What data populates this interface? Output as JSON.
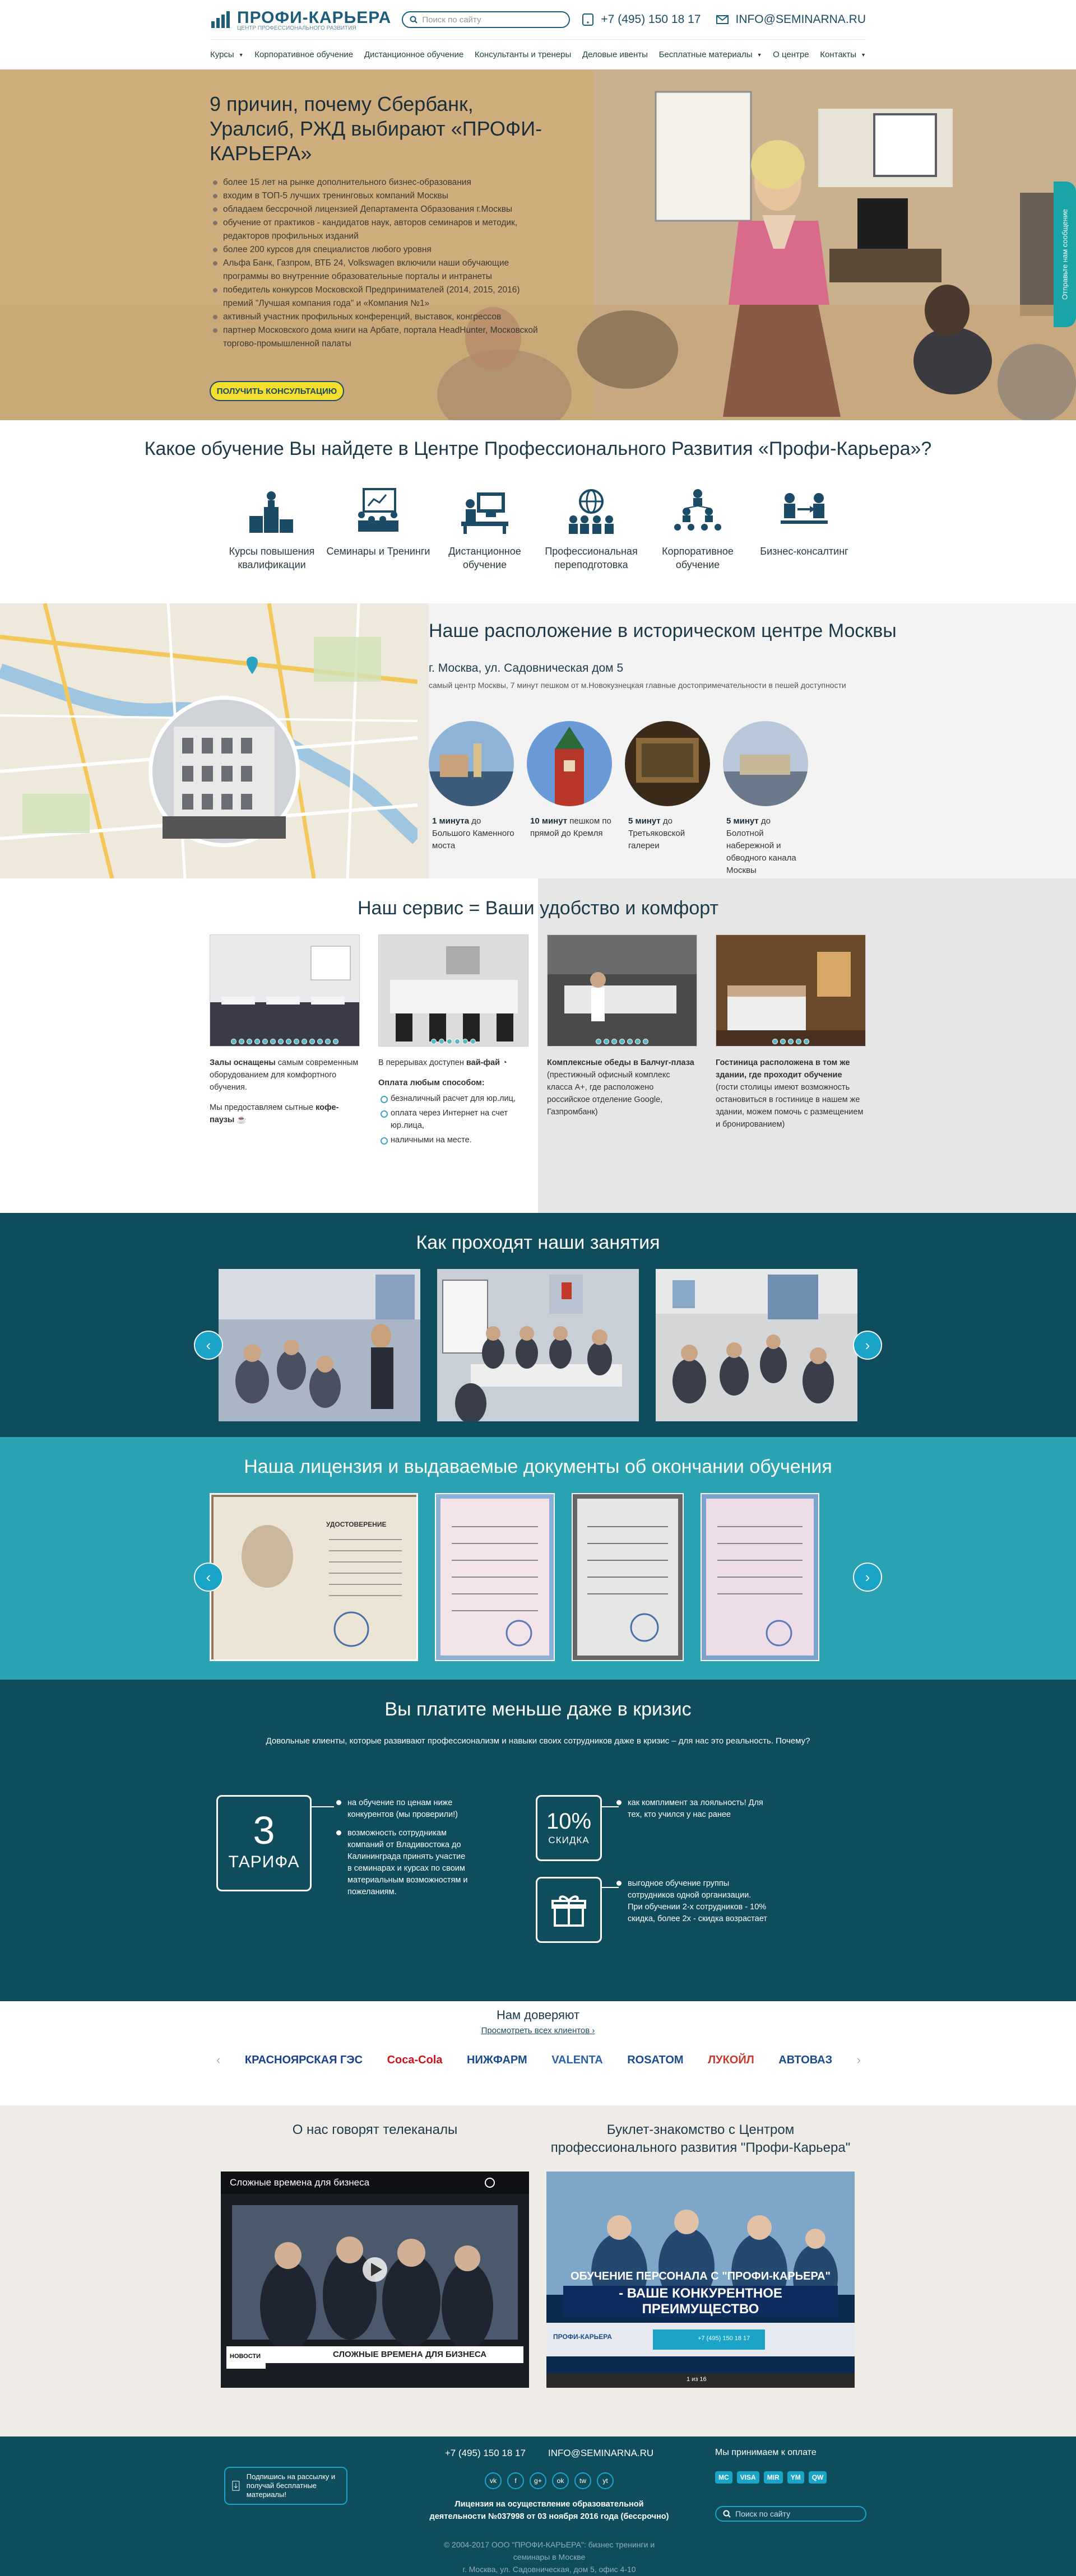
{
  "header": {
    "logo_name": "ПРОФИ-КАРЬЕРА",
    "logo_tagline": "ЦЕНТР ПРОФЕССИОНАЛЬНОГО РАЗВИТИЯ",
    "search_placeholder": "Поиск по сайту",
    "phone": "+7 (495) 150 18 17",
    "email": "INFO@SEMINARNA.RU",
    "nav": [
      {
        "label": "Курсы",
        "caret": true
      },
      {
        "label": "Корпоративное обучение",
        "caret": false
      },
      {
        "label": "Дистанционное обучение",
        "caret": false
      },
      {
        "label": "Консультанты и тренеры",
        "caret": false
      },
      {
        "label": "Деловые ивенты",
        "caret": false
      },
      {
        "label": "Бесплатные материалы",
        "caret": true
      },
      {
        "label": "О центре",
        "caret": false
      },
      {
        "label": "Контакты",
        "caret": true
      }
    ]
  },
  "hero": {
    "title": "9 причин, почему Сбербанк, Уралсиб, РЖД выбирают «ПРОФИ-КАРЬЕРА»",
    "reasons": [
      "более 15 лет на рынке дополнительного бизнес-образования",
      "входим в ТОП-5 лучших тренинговых компаний Москвы",
      "обладаем бессрочной лицензией Департамента Образования г.Москвы",
      "обучение от практиков - кандидатов наук, авторов семинаров и методик, редакторов профильных изданий",
      "более 200 курсов для специалистов любого уровня",
      "Альфа Банк, Газпром, ВТБ 24, Volkswagen включили наши обучающие программы во внутренние образовательные порталы и интранеты",
      "победитель конкурсов Московской Предпринимателей (2014, 2015, 2016) премий \"Лучшая компания года\" и «Компания №1»",
      "активный участник профильных конференций, выставок, конгрессов",
      "партнер Московского дома книги на Арбате, портала HeadHunter, Московской торгово-промышленной палаты"
    ],
    "cta": "ПОЛУЧИТЬ КОНСУЛЬТАЦИЮ",
    "side_tab": "Отправьте нам сообщение"
  },
  "training": {
    "title": "Какое обучение Вы найдете в Центре Профессионального Развития «Профи-Карьера»?",
    "items": [
      {
        "label": "Курсы повышения квалификации",
        "icon": "podium-icon"
      },
      {
        "label": "Семинары и Тренинги",
        "icon": "presentation-board-icon"
      },
      {
        "label": "Дистанционное обучение",
        "icon": "computer-desk-icon"
      },
      {
        "label": "Профессиональная переподготовка",
        "icon": "people-globe-icon"
      },
      {
        "label": "Корпоративное обучение",
        "icon": "team-pyramid-icon"
      },
      {
        "label": "Бизнес-консалтинг",
        "icon": "consulting-icon"
      }
    ]
  },
  "location": {
    "title": "Наше расположение в историческом центре Москвы",
    "address": "г. Москва, ул. Садовническая дом 5",
    "sub": "самый центр Москвы, 7 минут пешком от м.Новокузнецкая главные достопримечательности в пешей доступности",
    "items": [
      {
        "bold": "1 минута",
        "text": " до Большого Каменного моста"
      },
      {
        "bold": "10 минут",
        "text": " пешком по прямой до Кремля"
      },
      {
        "bold": "5 минут",
        "text": " до Третьяковской галереи"
      },
      {
        "bold": "5 минут",
        "text": " до Болотной набережной и обводного канала Москвы"
      }
    ]
  },
  "service": {
    "title": "Наш сервис = Ваши удобство и комфорт",
    "cards": [
      {
        "bold": "Залы оснащены",
        "text": " самым современным оборудованием для комфортного обучения.",
        "extra": "Мы предоставляем сытные ",
        "extra_bold": "кофе-паузы",
        "dots": 14
      },
      {
        "intro": "В перерывах доступен ",
        "intro_bold": "вай-фай",
        "pay_title": "Оплата любым способом:",
        "list": [
          "безналичный расчет для юр.лиц,",
          "оплата через Интернет на счет юр.лица,",
          "наличными на месте."
        ],
        "dots": 6
      },
      {
        "bold": "Комплексные обеды в Балчуг-плаза",
        "text": " (престижный офисный комплекс класса А+, где расположено российское отделение Google, Газпромбанк)",
        "dots": 7
      },
      {
        "bold": "Гостиница расположена в том же здании, где проходит обучение",
        "text": " (гости столицы имеют возможность остановиться в гостинице в нашем же здании, можем помочь с размещением и бронированием)",
        "dots": 5
      }
    ]
  },
  "lessons": {
    "title": "Как проходят наши занятия"
  },
  "license": {
    "title": "Наша лицензия и выдаваемые документы об окончании обучения",
    "doc_title": "УДОСТОВЕРЕНИЕ"
  },
  "pay": {
    "title": "Вы платите меньше даже в кризис",
    "sub": "Довольные клиенты, которые развивают профессионализм и навыки своих сотрудников даже в кризис – для нас это реальность. Почему?",
    "tariff_number": "3",
    "tariff_label": "ТАРИФА",
    "tariff_points": [
      "на обучение по ценам ниже конкурентов (мы проверили!)",
      "возможность сотрудникам компаний от Владивостока до Калининграда принять участие в семинарах и курсах по своим материальным возможностям и пожеланиям."
    ],
    "discount_big": "10%",
    "discount_label": "СКИДКА",
    "discount_text": "как комплимент за лояльность! Для тех, кто учился у нас ранее",
    "group_text": "выгодное обучение группы сотрудников одной организации. При обучении 2-х сотрудников - 10% скидка, более 2х - скидка возрастает"
  },
  "clients": {
    "title": "Нам доверяют",
    "link": "Просмотреть всех клиентов ›",
    "logos": [
      {
        "label": "КРАСНОЯРСКАЯ ГЭС",
        "color": "#1b3f8a"
      },
      {
        "label": "Coca-Cola",
        "color": "#d0121b"
      },
      {
        "label": "НИЖФАРМ",
        "color": "#1b4b8a"
      },
      {
        "label": "VALENTA",
        "color": "#2b5fa8"
      },
      {
        "label": "ROSATOM",
        "color": "#1b4b8a"
      },
      {
        "label": "ЛУКОЙЛ",
        "color": "#c83a2a"
      },
      {
        "label": "АВТОВАЗ",
        "color": "#1b4b8a"
      }
    ]
  },
  "media": {
    "left_title": "О нас говорят телеканалы",
    "right_title": "Буклет-знакомство с Центром профессионального развития \"Профи-Карьера\"",
    "video_title": "Сложные времена для бизнеса",
    "video_caption": "СЛОЖНЫЕ ВРЕМЕНА ДЛЯ БИЗНЕСА",
    "video_logo": "НОВОСТИ",
    "booklet_line1": "ОБУЧЕНИЕ ПЕРСОНАЛА С \"ПРОФИ-КАРЬЕРА\"",
    "booklet_line2": "- ВАШЕ КОНКУРЕНТНОЕ ПРЕИМУЩЕСТВО",
    "booklet_phone": "+7 (495) 150 18 17",
    "booklet_counter": "1 из 16"
  },
  "footer": {
    "subscribe": "Подпишись на рассылку и получай бесплатные материалы!",
    "phone": "+7 (495) 150 18 17",
    "email": "INFO@SEMINARNA.RU",
    "license": "Лицензия на осуществление образовательной деятельности №037998 от 03 ноября 2016 года (бессрочно)",
    "copyright": "© 2004-2017 ООО \"ПРОФИ-КАРЬЕРА\": бизнес тренинги и семинары в Москве",
    "address": "г. Москва, ул. Садовническая, дом 5, офис 4-10",
    "pay_title": "Мы принимаем к оплате",
    "search_placeholder": "Поиск по сайту",
    "social": [
      "vk",
      "f",
      "g+",
      "ok",
      "tw",
      "yt"
    ],
    "pay_icons": [
      "MC",
      "VISA",
      "MIR",
      "YM",
      "QW"
    ]
  },
  "colors": {
    "primary": "#1b5d7a",
    "teal": "#2ba3b3",
    "dark_teal": "#0f4d5c",
    "accent": "#f3dd2d"
  }
}
